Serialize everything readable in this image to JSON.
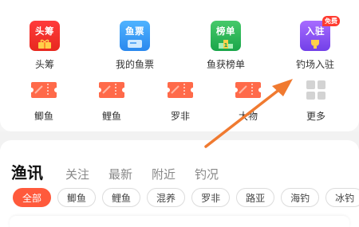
{
  "top_row": [
    {
      "label": "头筹",
      "tile_text": "头筹",
      "color": "#f0302a",
      "icon": "gift-icon"
    },
    {
      "label": "我的鱼票",
      "tile_text": "鱼票",
      "color": "#3b9ef8",
      "icon": "ticket-card-icon"
    },
    {
      "label": "鱼获榜单",
      "tile_text": "榜单",
      "color": "#2fb957",
      "icon": "podium-icon"
    },
    {
      "label": "钓场入驻",
      "tile_text": "入驻",
      "color": "#8a55f5",
      "icon": "trophy-icon",
      "badge": "免费"
    }
  ],
  "second_row": [
    {
      "label": "鲫鱼",
      "icon": "ticket-icon"
    },
    {
      "label": "鲤鱼",
      "icon": "ticket-icon"
    },
    {
      "label": "罗非",
      "icon": "ticket-icon"
    },
    {
      "label": "大物",
      "icon": "ticket-icon"
    },
    {
      "label": "更多",
      "icon": "more-grid-icon"
    }
  ],
  "feed_tabs": [
    "渔讯",
    "关注",
    "最新",
    "附近",
    "钓况"
  ],
  "filter_chips": [
    "全部",
    "鲫鱼",
    "鲤鱼",
    "混养",
    "罗非",
    "路亚",
    "海钓",
    "冰钓"
  ],
  "colors": {
    "accent": "#ff5a3c",
    "ticket": "#ff6a4a",
    "arrow": "#f07a30"
  }
}
